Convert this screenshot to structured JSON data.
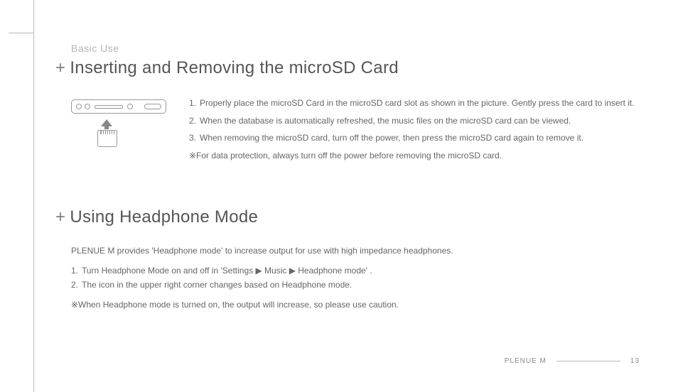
{
  "page": {
    "section_label": "Basic Use",
    "brand": "PLENUE M",
    "page_number": "13"
  },
  "section1": {
    "title": "Inserting and Removing the microSD Card",
    "items": [
      {
        "n": "1.",
        "t": "Properly place the microSD Card in the microSD card slot as shown in the picture. Gently press the card to insert it."
      },
      {
        "n": "2.",
        "t": "When the database is automatically refreshed, the music files on the microSD card can be viewed."
      },
      {
        "n": "3.",
        "t": "When removing the microSD card, turn off the power, then press the microSD card again to remove it."
      }
    ],
    "note": "※For data protection, always turn off the power before removing the microSD card."
  },
  "section2": {
    "title": "Using Headphone Mode",
    "intro": "PLENUE M provides 'Headphone mode' to increase output for use with high impedance headphones.",
    "items": [
      {
        "n": "1.",
        "t": "Turn Headphone Mode on and off in 'Settings ▶ Music ▶ Headphone mode' ."
      },
      {
        "n": "2.",
        "t": "The icon in the upper right corner changes based on Headphone mode."
      }
    ],
    "note": "※When Headphone mode is turned on, the output will increase, so please use caution."
  }
}
